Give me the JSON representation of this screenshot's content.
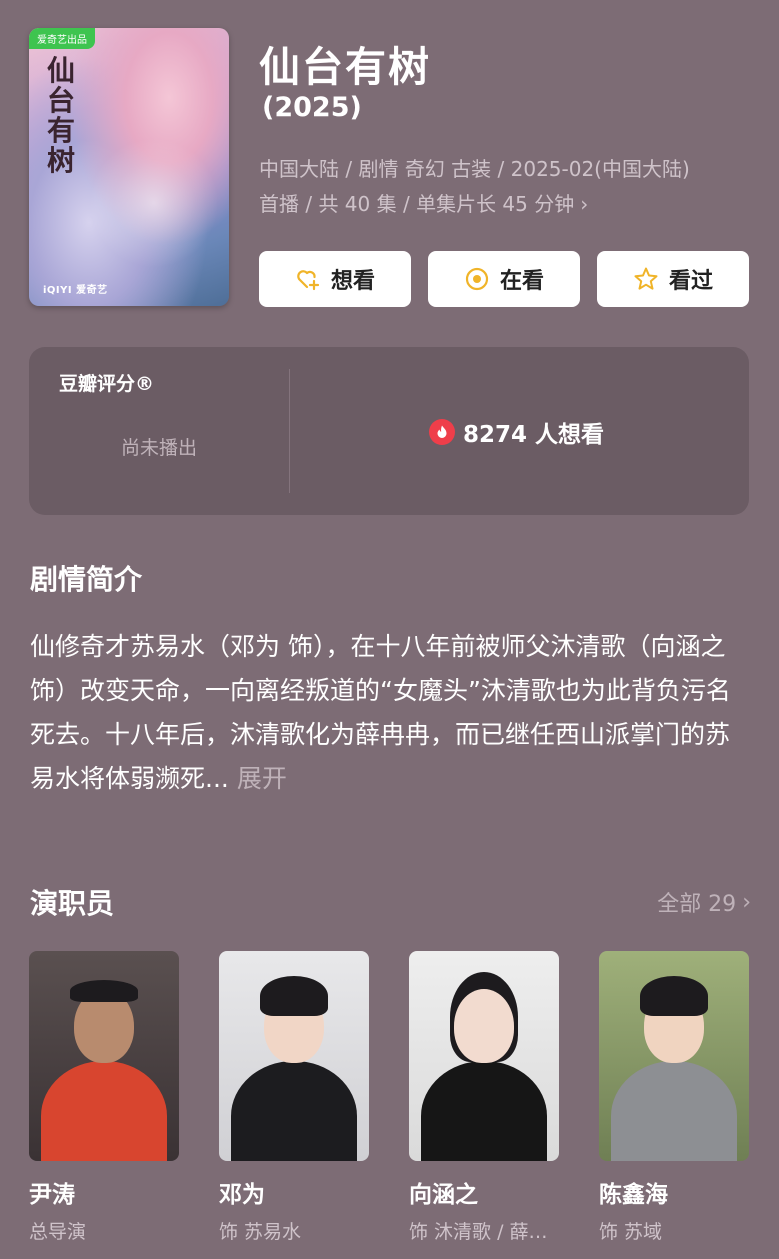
{
  "movie": {
    "title": "仙台有树",
    "year": "(2025)",
    "meta_line1": "中国大陆 / 剧情 奇幻 古装 / 2025-02(中国大陆)",
    "meta_line2": "首播 / 共 40 集 / 单集片长 45 分钟",
    "poster": {
      "badge": "爱奇艺出品",
      "calligraphy": "仙台有树",
      "logo": "iQIYI 爱奇艺"
    }
  },
  "actions": {
    "want_label": "想看",
    "watching_label": "在看",
    "watched_label": "看过"
  },
  "rating": {
    "title": "豆瓣评分®",
    "status": "尚未播出",
    "want_count": "8274 人想看",
    "fire_color": "#ef3e4a"
  },
  "synopsis": {
    "heading": "剧情简介",
    "text": "仙修奇才苏易水（邓为 饰），在十八年前被师父沐清歌（向涵之 饰）改变天命，一向离经叛道的“女魔头”沐清歌也为此背负污名死去。十八年后，沐清歌化为薛冉冉，而已继任西山派掌门的苏易水将体弱濒死...",
    "expand_label": "展开"
  },
  "cast": {
    "heading": "演职员",
    "all_label": "全部 29",
    "members": [
      {
        "name": "尹涛",
        "role": "总导演"
      },
      {
        "name": "邓为",
        "role": "饰 苏易水"
      },
      {
        "name": "向涵之",
        "role": "饰 沐清歌 / 薛冉冉"
      },
      {
        "name": "陈鑫海",
        "role": "饰 苏域"
      }
    ]
  },
  "colors": {
    "background": "#7d6c75",
    "card": "#6b5c64",
    "accent_yellow": "#f0b429"
  }
}
